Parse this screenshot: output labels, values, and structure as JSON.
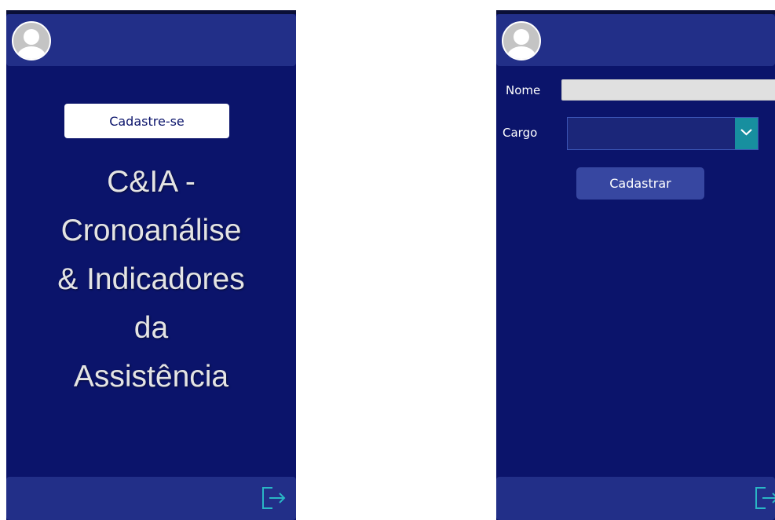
{
  "screen_signup_prompt": {
    "avatar_icon": "user-avatar-icon",
    "signup_button_label": "Cadastre-se",
    "app_title_lines": [
      "C&IA -",
      "Cronoanálise",
      "& Indicadores",
      "da",
      "Assistência"
    ],
    "exit_icon": "logout-icon"
  },
  "screen_register_form": {
    "avatar_icon": "user-avatar-icon",
    "name_label": "Nome",
    "name_value": "",
    "cargo_label": "Cargo",
    "cargo_selected": "",
    "chevron_icon": "chevron-down-icon",
    "register_button_label": "Cadastrar",
    "exit_icon": "logout-icon"
  },
  "colors": {
    "screen_background": "#0b146b",
    "header_footer": "#222f88",
    "dropdown_accent": "#178f9f",
    "icon_accent": "#2ab6c5"
  }
}
